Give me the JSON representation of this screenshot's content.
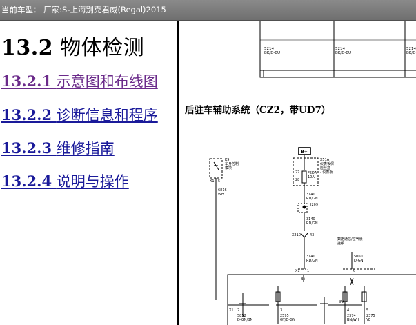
{
  "titlebar": {
    "text": "当前车型： 厂家:S-上海别克君威(Regal)2015"
  },
  "section": {
    "number": "13.2",
    "title": "物体检测"
  },
  "links": [
    {
      "number": "13.2.1",
      "label": "示意图和布线图"
    },
    {
      "number": "13.2.2",
      "label": "诊断信息和程序"
    },
    {
      "number": "13.2.3",
      "label": "维修指南"
    },
    {
      "number": "13.2.4",
      "label": "说明与操作"
    }
  ],
  "top_diagram": {
    "wire_left": "5214",
    "wire_left_color": "BK/D-BU",
    "wire_mid": "5214",
    "wire_mid_color": "BK/D-BU",
    "wire_right": "5214",
    "wire_right_color": "BK/D"
  },
  "diagram": {
    "title": "后驻车辅助系统（CZ2，带UD7）",
    "b_plus": "B+",
    "x51a_label": "X51A",
    "x51a_desc1": "仪表板保",
    "x51a_desc2": "险丝盒",
    "x51a_desc3": "- 仪表板",
    "pin27": "27",
    "pin28": "28",
    "fuse": "F5DA",
    "fuse_amp": "10A",
    "k9_label": "K9",
    "k9_desc1": "车身控制",
    "k9_desc2": "模块",
    "x1_5_conn": "X1",
    "x1_5_pin": "5",
    "w6816": "6816",
    "w6816_color": "WH",
    "w3140a": "3140",
    "w3140a_color": "RD/GN",
    "j209": "J209",
    "w3140b": "3140",
    "w3140b_color": "RD/GN",
    "x210": "X210",
    "x210_pin": "43",
    "w3140c": "3140",
    "w3140c_color": "RD/GN",
    "data_label1": "数据通信/空气悬",
    "data_label2": "挂系",
    "w5060": "5060",
    "w5060_color": "D-GN",
    "x1_conn": "X1",
    "x1_pin1": "1",
    "x1_pin6": "6",
    "module_bplus": "B+",
    "v8": "8V",
    "x1b_conn": "X1",
    "x1b_pin2": "2",
    "x1b_pin3": "3",
    "x1b_pin4": "4",
    "x1b_pin5": "5",
    "w5852": "5852",
    "w5852_color": "D-GN/BN",
    "w2595": "2595",
    "w2595_color": "GY/D-GN",
    "w2374": "2374",
    "w2374_color": "BN/WH",
    "w2375": "2375",
    "w2375_color": "YE"
  }
}
